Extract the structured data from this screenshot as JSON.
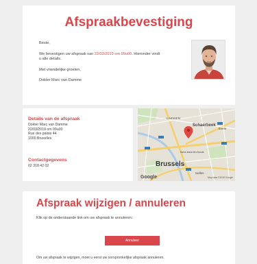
{
  "header": {
    "title": "Afspraakbevestiging"
  },
  "message": {
    "salutation": "Beste,",
    "line1_before": "We bevestigen uw afspraak van ",
    "appointment_datetime": "22/03/2019 om 09u00",
    "line1_after": ". Hieronder vindt",
    "line2": "u alle details.",
    "closing": "Met vriendelijke groeten,",
    "signature": "Dokter Marc van Damme"
  },
  "details": {
    "heading": "Details van de afspraak",
    "lines": [
      "Dokter Marc van Damme",
      "22/03/2019 om 09u00",
      "Rue des palais 44",
      "1000 Bruxelles"
    ],
    "contact_heading": "Contactgegevens",
    "phone": "02 318 42 02"
  },
  "map": {
    "labels": {
      "laeken": "LAEKEN",
      "evere": "Evere",
      "schaerbeek": "Schaerbeek",
      "brussels": "Brussels",
      "saint_josse": "Saint-Josse-ten-Noode",
      "ixelles": "Ixelles"
    },
    "google": "Google",
    "credit": "Map data ©2019 Google"
  },
  "change": {
    "title": "Afspraak wijzigen / annuleren",
    "text": "Klik op de onderstaande link om uw afspraak te annuleren:",
    "button_label": "Annuleer",
    "footer": "Om uw afspraak te wijzigen, moet u eerst uw oorspronkelijke afspraak annuleren."
  },
  "colors": {
    "accent": "#d9464b",
    "background": "#efefef",
    "card": "#ffffff"
  }
}
